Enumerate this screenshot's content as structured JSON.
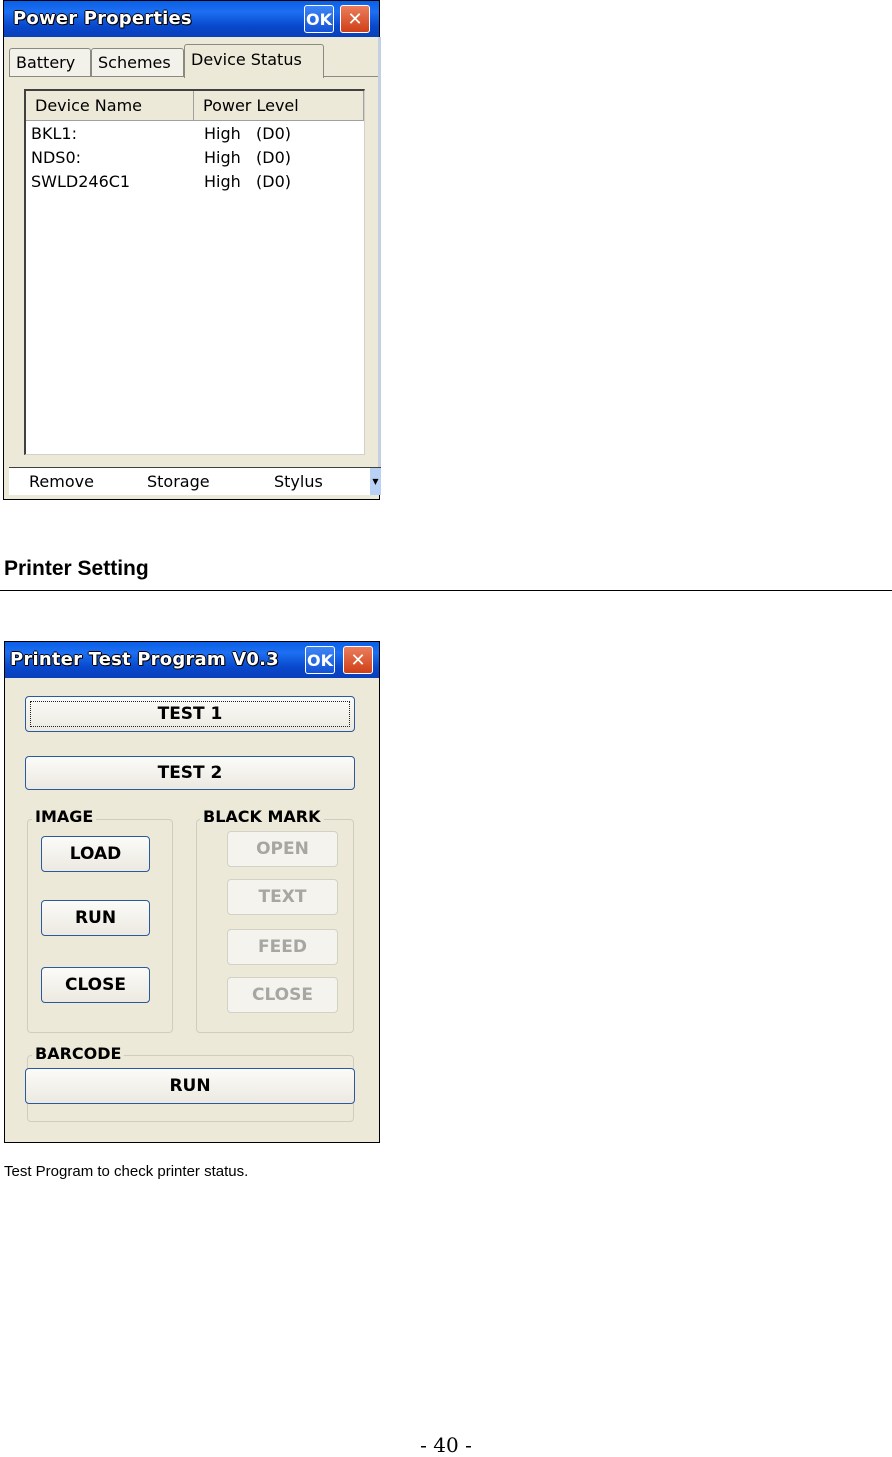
{
  "power_window": {
    "title": "Power Properties",
    "ok_label": "OK",
    "close_glyph": "✕",
    "tabs": [
      {
        "label": "Battery",
        "active": false
      },
      {
        "label": "Schemes",
        "active": false
      },
      {
        "label": "Device Status",
        "active": true
      }
    ],
    "list": {
      "columns": [
        "Device Name",
        "Power Level"
      ],
      "rows": [
        {
          "name": "BKL1:",
          "level": "High   (D0)"
        },
        {
          "name": "NDS0:",
          "level": "High   (D0)"
        },
        {
          "name": "SWLD246C1",
          "level": "High   (D0)"
        }
      ]
    },
    "bottom_tabs": [
      "Remove",
      "Storage",
      "Stylus"
    ],
    "scroll_arrow_glyph": "▼"
  },
  "section": {
    "heading": "Printer Setting",
    "caption": "Test Program to check printer status."
  },
  "printer_window": {
    "title": "Printer Test Program V0.3",
    "ok_label": "OK",
    "close_glyph": "✕",
    "test1_label": "TEST 1",
    "test2_label": "TEST 2",
    "image_group": {
      "label": "IMAGE",
      "buttons": [
        "LOAD",
        "RUN",
        "CLOSE"
      ]
    },
    "black_mark_group": {
      "label": "BLACK MARK",
      "buttons": [
        "OPEN",
        "TEXT",
        "FEED",
        "CLOSE"
      ]
    },
    "barcode_group": {
      "label": "BARCODE",
      "run_label": "RUN"
    }
  },
  "page_number": "- 40 -"
}
